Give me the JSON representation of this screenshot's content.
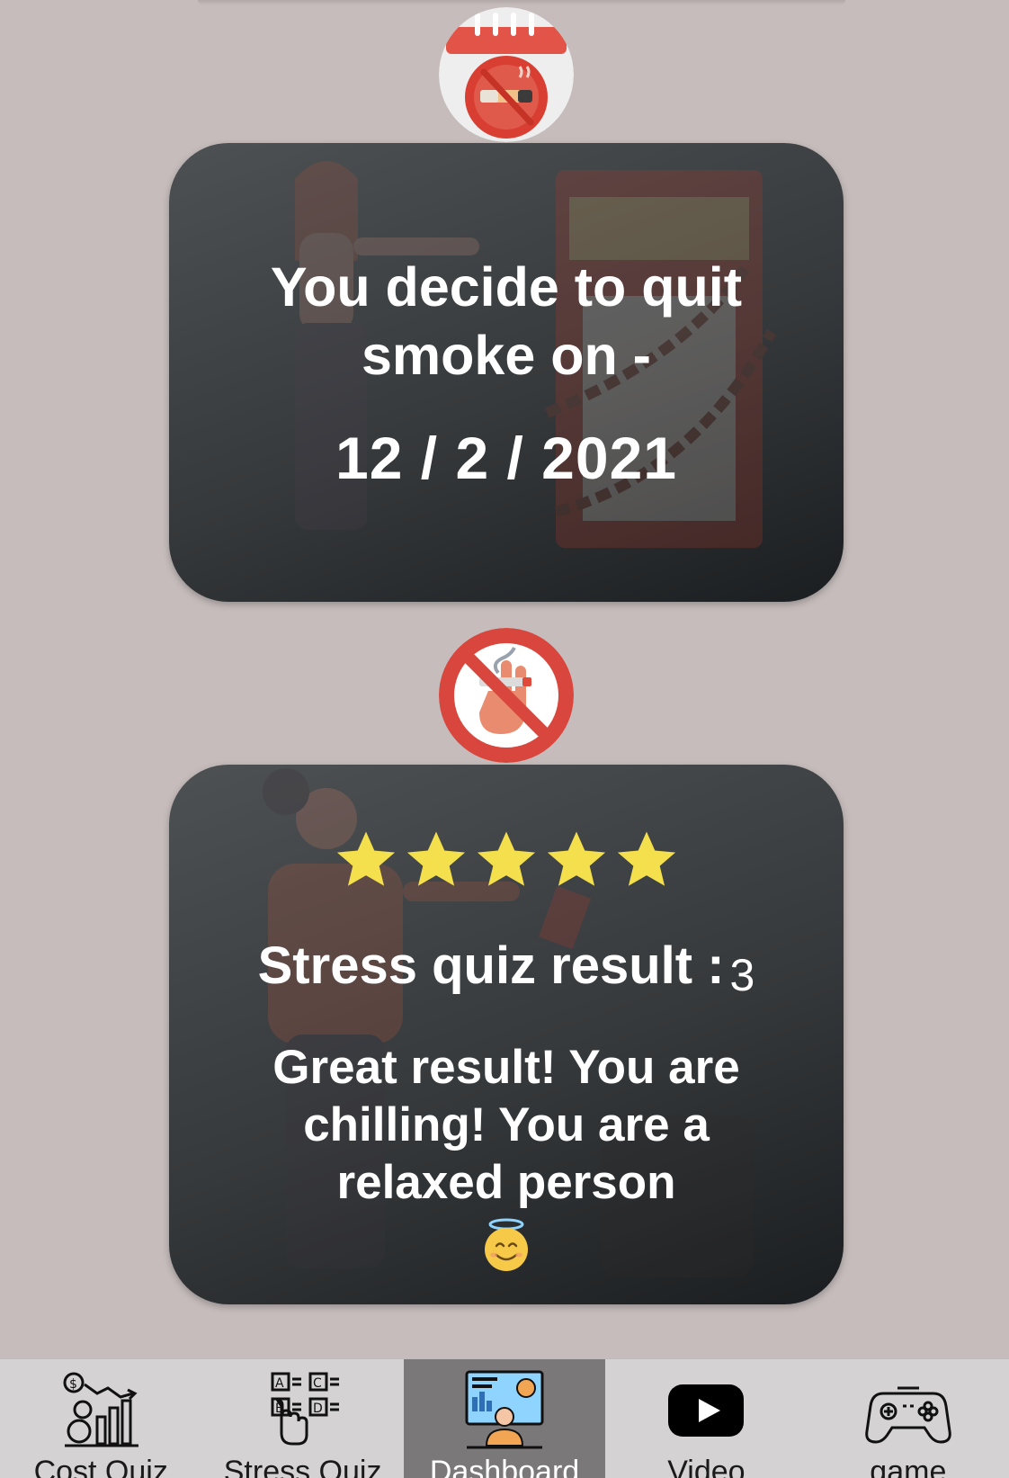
{
  "quit_card": {
    "heading": "You decide to quit smoke on -",
    "date": "12 / 2 / 2021"
  },
  "stress_card": {
    "rating_stars": 5,
    "rating_max": 5,
    "result_label": "Stress quiz result :",
    "result_score": "3",
    "message": "Great result! You are chilling! You are a relaxed person",
    "emoji": "😇"
  },
  "icons": {
    "top_badge": "no-smoking-calendar-icon",
    "middle_badge": "no-smoking-hand-icon",
    "star": "star-icon",
    "emoji": "smiling-face-with-halo-emoji"
  },
  "tabbar": {
    "tabs": [
      {
        "label": "Cost Quiz",
        "icon": "cost-chart-icon",
        "active": false
      },
      {
        "label": "Stress Quiz",
        "icon": "quiz-abcd-icon",
        "active": false
      },
      {
        "label": "Dashboard",
        "icon": "dashboard-presenter-icon",
        "active": true
      },
      {
        "label": "Video",
        "icon": "youtube-play-icon",
        "active": false
      },
      {
        "label": "game",
        "icon": "gamepad-icon",
        "active": false
      }
    ]
  },
  "colors": {
    "page_background": "#c6bcbc",
    "card_background": "#3a3d3f",
    "star": "#f4e04d",
    "badge_red": "#d9463d",
    "tabbar_background": "#d4d2d3",
    "active_tab": "#7a7878"
  }
}
